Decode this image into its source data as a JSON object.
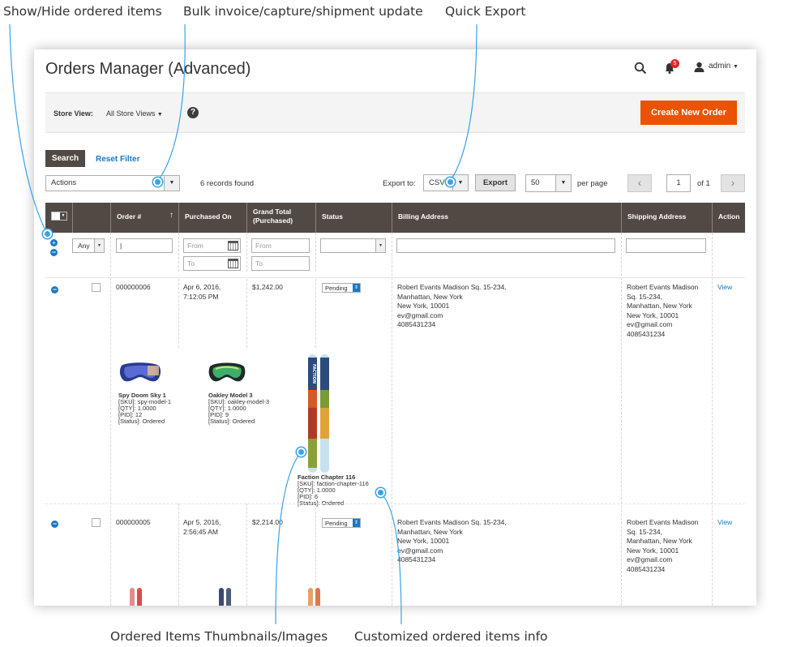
{
  "callouts": {
    "show_hide": "Show/Hide ordered items",
    "bulk_update": "Bulk invoice/capture/shipment update",
    "quick_export": "Quick Export",
    "thumbnails": "Ordered Items Thumbnails/Images",
    "customized_info": "Customized ordered items info"
  },
  "header": {
    "title": "Orders Manager (Advanced)",
    "notification_count": "5",
    "user": "admin"
  },
  "store_view": {
    "label": "Store View:",
    "value": "All Store Views",
    "help": "?"
  },
  "create_button": "Create New Order",
  "toolbar": {
    "search_label": "Search",
    "reset_label": "Reset Filter",
    "actions_value": "Actions",
    "records_found": "6 records found",
    "export_to_label": "Export to:",
    "export_format": "CSV",
    "export_button": "Export",
    "per_page_value": "50",
    "per_page_label": "per page",
    "page_current": "1",
    "page_total": "of 1"
  },
  "columns": {
    "order": "Order #",
    "purchased_on": "Purchased On",
    "grand_total_1": "Grand Total",
    "grand_total_2": "(Purchased)",
    "status": "Status",
    "billing": "Billing Address",
    "shipping": "Shipping Address",
    "action": "Action"
  },
  "filters": {
    "any": "Any",
    "from": "From",
    "to": "To"
  },
  "orders": [
    {
      "id": "000000006",
      "date": "Apr 6, 2016,",
      "time": "7:12:05 PM",
      "total": "$1,242.00",
      "status": "Pending",
      "billing": [
        "Robert Evants Madison Sq. 15-234,",
        "Manhattan, New York",
        "New York, 10001",
        "ev@gmail.com",
        "4085431234"
      ],
      "shipping": [
        "Robert Evants Madison",
        "Sq. 15-234,",
        "Manhattan, New York",
        "New York, 10001",
        "ev@gmail.com",
        "4085431234"
      ],
      "action": "View",
      "items": [
        {
          "name": "Spy Doom Sky 1",
          "sku": "[SKU]: spy-model-1",
          "qty": "[QTY]: 1.0000",
          "pid": "[PID]: 12",
          "status": "[Status]: Ordered"
        },
        {
          "name": "Oakley Model 3",
          "sku": "[SKU]: oakley-model-3",
          "qty": "[QTY]: 1.0000",
          "pid": "[PID]: 9",
          "status": "[Status]: Ordered"
        },
        {
          "name": "Faction Chapter 116",
          "sku": "[SKU]: faction-chapter-116",
          "qty": "[QTY]: 1.0000",
          "pid": "[PID]: 6",
          "status": "[Status]: Ordered"
        }
      ]
    },
    {
      "id": "000000005",
      "date": "Apr 5, 2016,",
      "time": "2:56:45 AM",
      "total": "$2,214.00",
      "status": "Pending",
      "billing": [
        "Robert Evants Madison Sq. 15-234,",
        "Manhattan, New York",
        "New York, 10001",
        "ev@gmail.com",
        "4085431234"
      ],
      "shipping": [
        "Robert Evants Madison",
        "Sq. 15-234,",
        "Manhattan, New York",
        "New York, 10001",
        "ev@gmail.com",
        "4085431234"
      ],
      "action": "View"
    }
  ],
  "ski_text": "FACTION",
  "colors": {
    "accent": "#eb5202",
    "header_bg": "#514943",
    "link": "#1979c3",
    "callout_dot": "#38a4e8"
  }
}
